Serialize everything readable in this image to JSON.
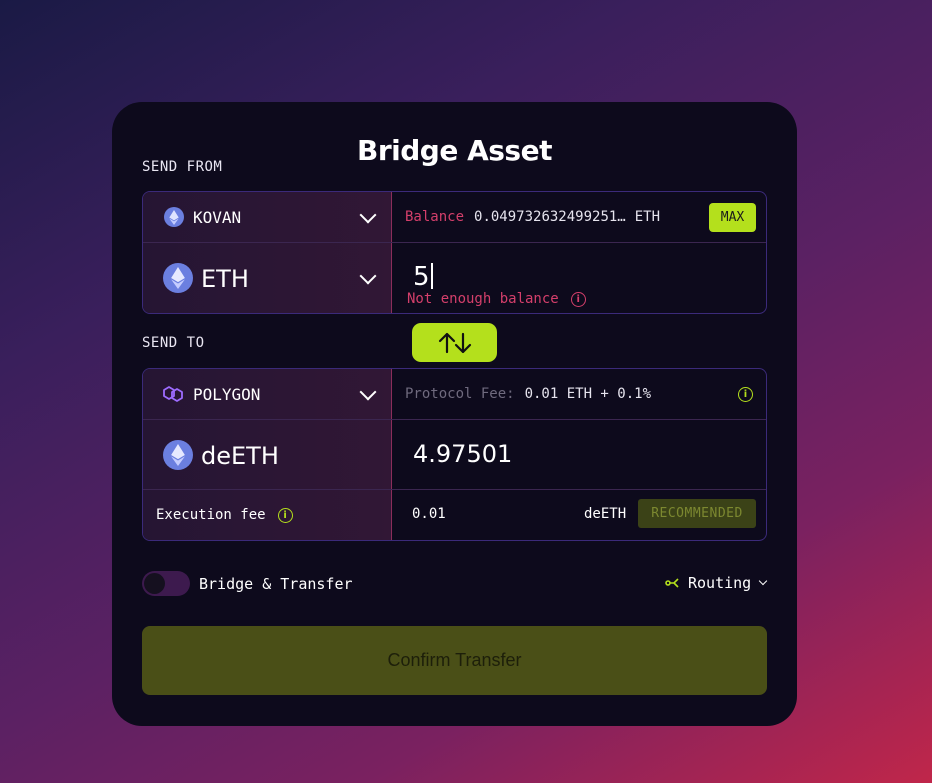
{
  "title": "Bridge Asset",
  "send_from": {
    "label": "SEND FROM",
    "network": "KOVAN",
    "token": "ETH",
    "balance_label": "Balance",
    "balance_value": "0.049732632499251…",
    "balance_unit": "ETH",
    "max_label": "MAX",
    "amount": "5",
    "error": "Not enough balance"
  },
  "swap_icon": "swap-arrows-icon",
  "send_to": {
    "label": "SEND TO",
    "network": "POLYGON",
    "fee_label": "Protocol Fee:",
    "fee_value": "0.01 ETH + 0.1%",
    "token": "deETH",
    "amount": "4.97501",
    "execution_fee_label": "Execution fee",
    "execution_fee_value": "0.01",
    "execution_fee_unit": "deETH",
    "recommended_label": "RECOMMENDED"
  },
  "bridge_transfer": {
    "label": "Bridge & Transfer",
    "enabled": false
  },
  "routing_label": "Routing",
  "confirm_label": "Confirm Transfer",
  "colors": {
    "accent": "#b4e01c",
    "error": "#d43f6b",
    "card": "#0d0a1c",
    "panel_border": "#3b2a7a"
  }
}
